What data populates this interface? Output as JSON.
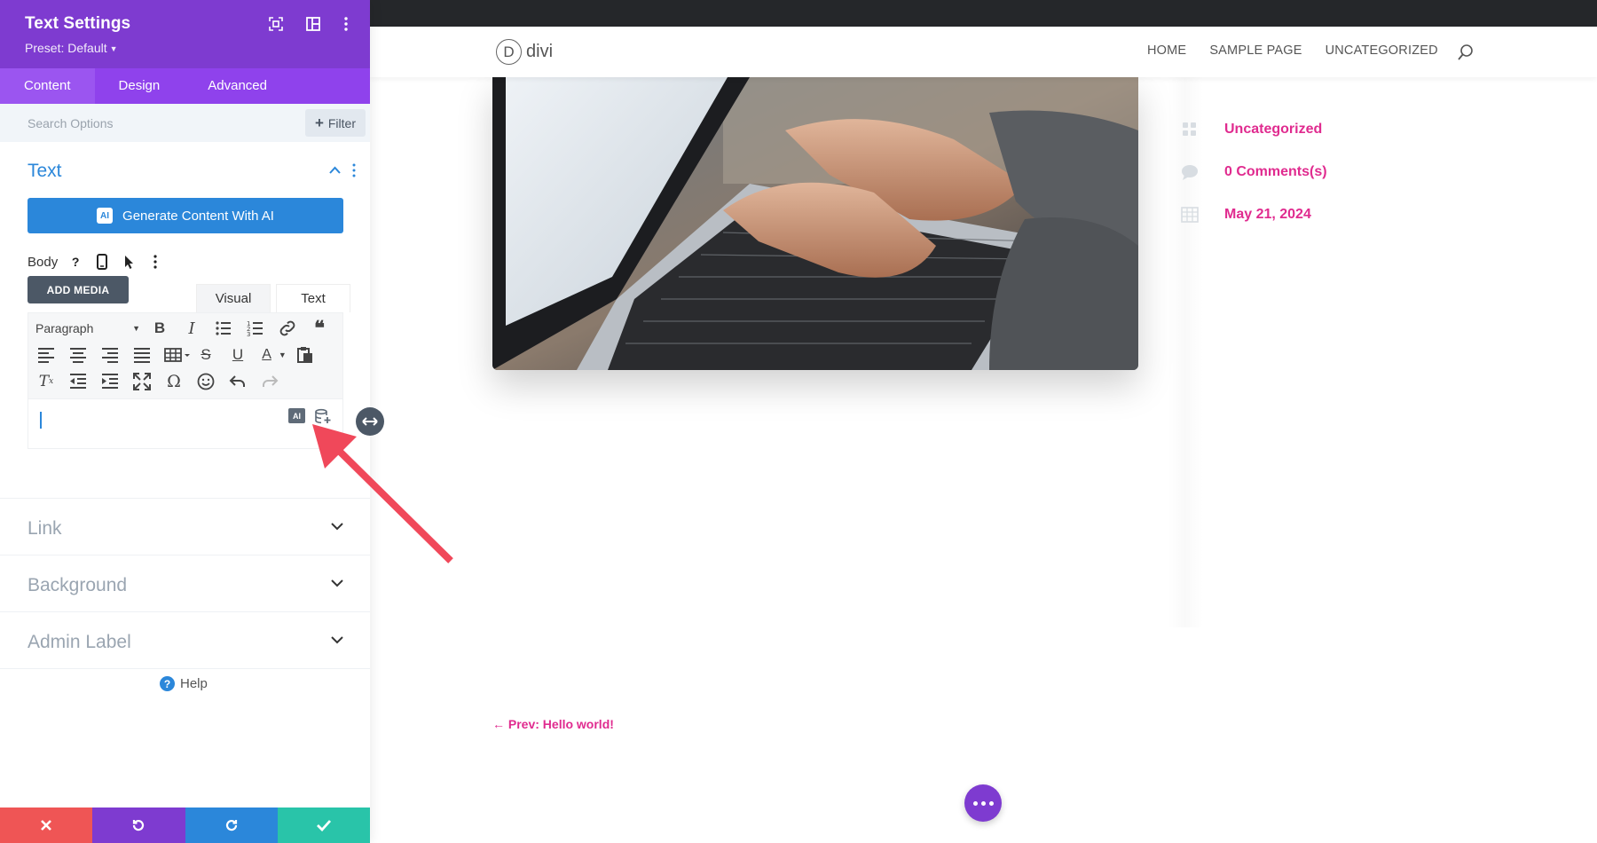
{
  "panel": {
    "title": "Text Settings",
    "preset": "Preset: Default",
    "tabs": [
      "Content",
      "Design",
      "Advanced"
    ],
    "search_placeholder": "Search Options",
    "filter_label": "Filter",
    "text_section": {
      "title": "Text",
      "ai_button": "Generate Content With AI",
      "ai_badge": "AI",
      "body_label": "Body",
      "add_media": "ADD MEDIA",
      "editor_tabs": [
        "Visual",
        "Text"
      ],
      "paragraph_select": "Paragraph"
    },
    "collapsed_sections": [
      "Link",
      "Background",
      "Admin Label"
    ],
    "help_label": "Help"
  },
  "site": {
    "logo_letter": "D",
    "logo_text": "divi",
    "nav": [
      "HOME",
      "SAMPLE PAGE",
      "UNCATEGORIZED"
    ],
    "meta": {
      "category": "Uncategorized",
      "comments": "0 Comments(s)",
      "date": "May 21, 2024"
    },
    "prev_link": "← Prev: Hello world!"
  },
  "colors": {
    "panel_purple": "#7e3bd0",
    "tab_purple": "#8f42ec",
    "accent_blue": "#2b87da",
    "link_pink": "#e02b8f",
    "cancel_red": "#ef5555",
    "undo_purple": "#7e3bd0",
    "redo_blue": "#2b87da",
    "save_green": "#29c4a9",
    "annotation_arrow": "#f0485a"
  }
}
